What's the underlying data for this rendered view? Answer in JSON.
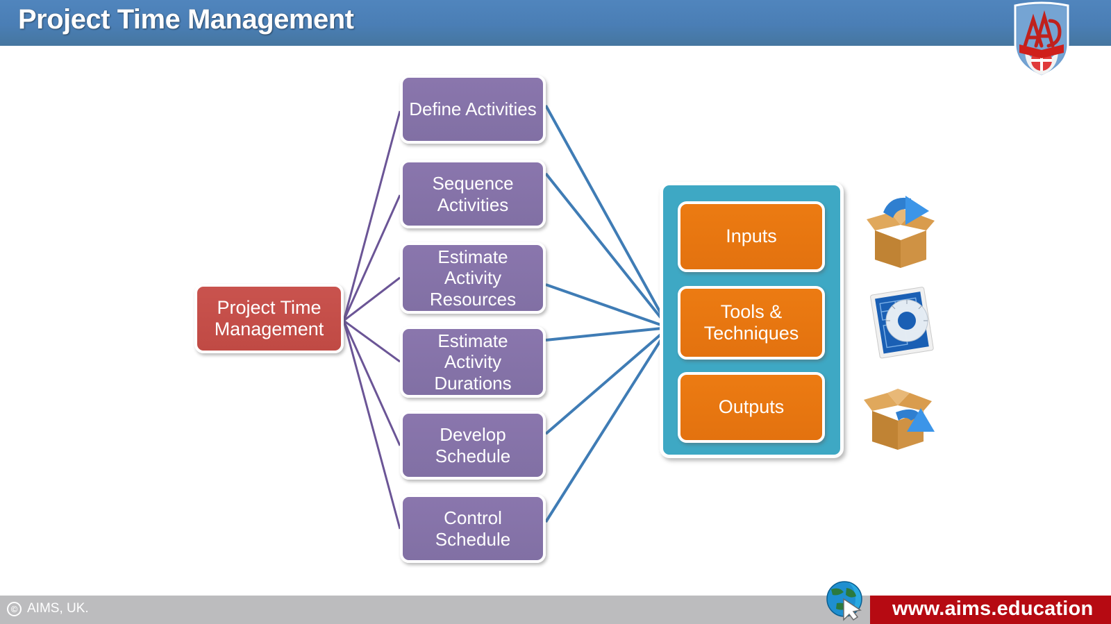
{
  "header": {
    "title": "Project Time Management",
    "logo_alt": "AIMS crest logo",
    "bar_color": "#4a7eb5"
  },
  "diagram": {
    "root": {
      "label_line1": "Project Time",
      "label_line2": "Management",
      "color": "#c4504b"
    },
    "processes": [
      {
        "label_line1": "Define Activities",
        "label_line2": "",
        "label_line3": ""
      },
      {
        "label_line1": "Sequence",
        "label_line2": "Activities",
        "label_line3": ""
      },
      {
        "label_line1": "Estimate",
        "label_line2": "Activity",
        "label_line3": "Resources"
      },
      {
        "label_line1": "Estimate",
        "label_line2": "Activity",
        "label_line3": "Durations"
      },
      {
        "label_line1": "Develop",
        "label_line2": "Schedule",
        "label_line3": ""
      },
      {
        "label_line1": "Control",
        "label_line2": "Schedule",
        "label_line3": ""
      }
    ],
    "process_color": "#8470a8",
    "io_group": {
      "container_color": "#3ea8c4",
      "item_color": "#e8761e",
      "items": [
        {
          "label_line1": "Inputs",
          "label_line2": "",
          "icon": "box-arrow-in-icon"
        },
        {
          "label_line1": "Tools &",
          "label_line2": "Techniques",
          "icon": "blueprint-protractor-icon"
        },
        {
          "label_line1": "Outputs",
          "label_line2": "",
          "icon": "box-arrow-out-icon"
        }
      ]
    },
    "connector_colors": {
      "root_to_process": "#6b5596",
      "process_to_io": "#3f7cb5"
    }
  },
  "footer": {
    "copyright_symbol": "©",
    "copyright_text": "AIMS, UK.",
    "url": "www.aims.education",
    "bar_color": "#bcbcbe",
    "url_bar_color": "#b60a12"
  }
}
